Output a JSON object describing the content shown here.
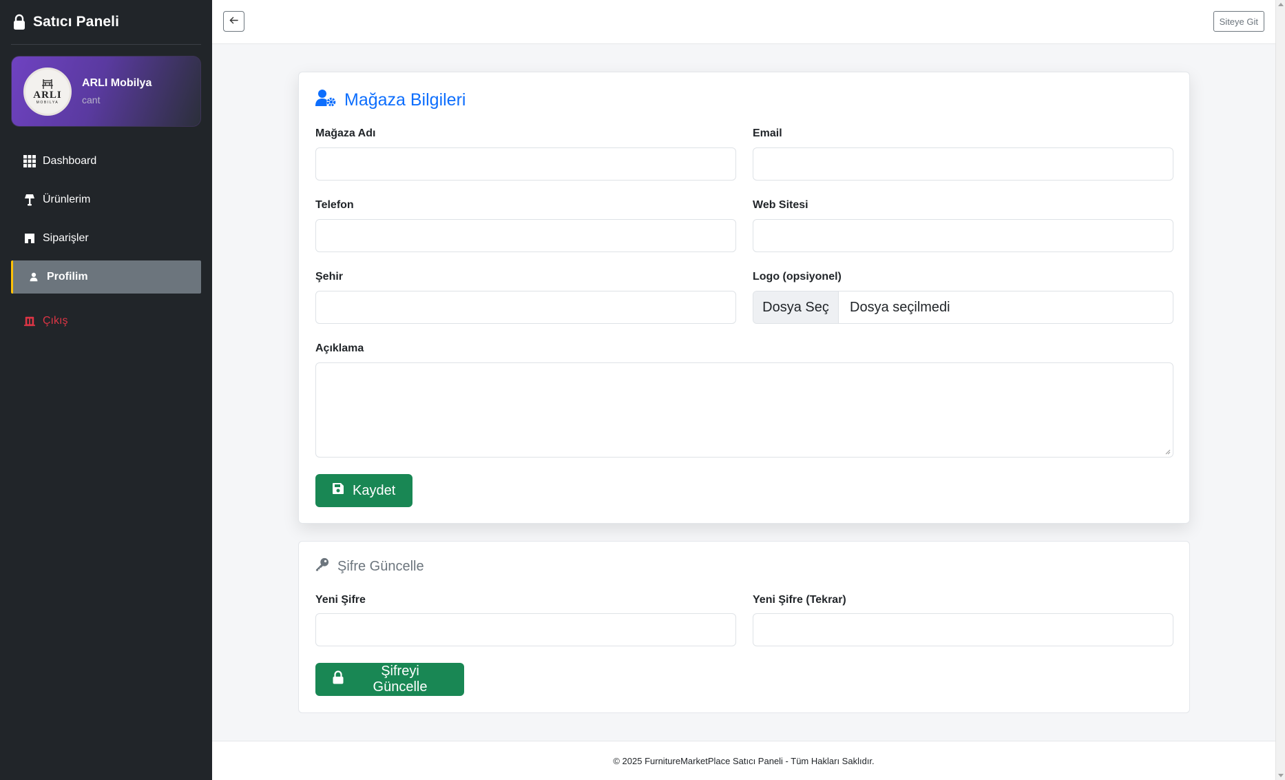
{
  "sidebar": {
    "title": "Satıcı Paneli",
    "brand_icon": "lock-icon",
    "profile": {
      "store_name": "ARLI Mobilya",
      "username": "cant",
      "avatar_logo_text": "ARLI",
      "avatar_logo_sub": "MOBILYA"
    },
    "items": [
      {
        "label": "Dashboard",
        "icon": "grid-icon",
        "active": false
      },
      {
        "label": "Ürünlerim",
        "icon": "lamp-icon",
        "active": false
      },
      {
        "label": "Siparişler",
        "icon": "shop-icon",
        "active": false
      },
      {
        "label": "Profilim",
        "icon": "person-icon",
        "active": true
      },
      {
        "label": "Çıkış",
        "icon": "door-icon",
        "active": false
      }
    ]
  },
  "topbar": {
    "back_icon": "arrow-left-icon",
    "site_button_label": "Siteye Git"
  },
  "store_card": {
    "title": "Mağaza Bilgileri",
    "title_icon": "user-gear-icon",
    "fields": {
      "store_name_label": "Mağaza Adı",
      "email_label": "Email",
      "phone_label": "Telefon",
      "website_label": "Web Sitesi",
      "city_label": "Şehir",
      "logo_label": "Logo (opsiyonel)",
      "logo_button": "Dosya Seç",
      "logo_status": "Dosya seçilmedi",
      "description_label": "Açıklama"
    },
    "values": {
      "store_name": "",
      "email": "",
      "phone": "",
      "website": "",
      "city": "",
      "description": ""
    },
    "save_label": "Kaydet",
    "save_icon": "floppy-disk-icon"
  },
  "password_card": {
    "title": "Şifre Güncelle",
    "title_icon": "key-icon",
    "new_password_label": "Yeni Şifre",
    "new_password_repeat_label": "Yeni Şifre (Tekrar)",
    "submit_label": "Şifreyi Güncelle",
    "submit_icon": "lock-icon"
  },
  "footer": {
    "text": "© 2025 FurnitureMarketPlace Satıcı Paneli - Tüm Hakları Saklıdır."
  },
  "colors": {
    "sidebar_bg": "#212529",
    "accent_primary": "#0d6efd",
    "success": "#198754",
    "danger": "#dc3545",
    "active_item": "#6c757d",
    "active_border": "#ffc107"
  }
}
